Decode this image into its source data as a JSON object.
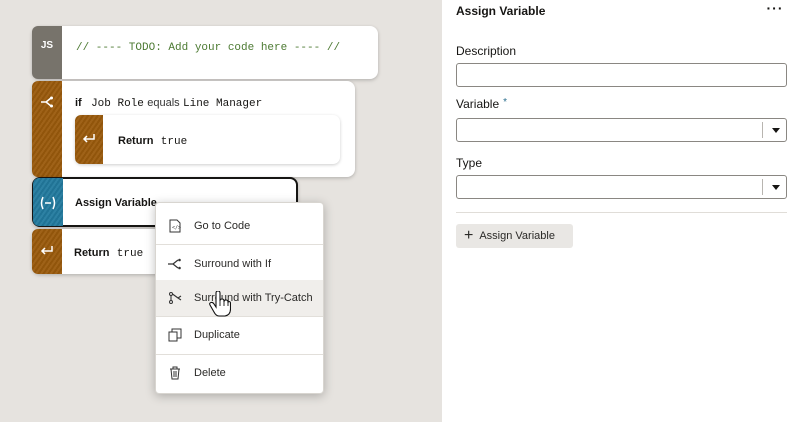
{
  "canvas": {
    "js_block": {
      "badge": "JS",
      "code": "// ---- TODO: Add your code here ---- //"
    },
    "if_block": {
      "keyword": "if",
      "left": "Job Role",
      "operator": "equals",
      "right": "Line Manager",
      "return": {
        "keyword": "Return",
        "value": "true"
      }
    },
    "assign_block": {
      "label": "Assign Variable"
    },
    "return_block": {
      "keyword": "Return",
      "value": "true"
    }
  },
  "context_menu": {
    "items": [
      {
        "label": "Go to Code",
        "icon": "code-file-icon"
      },
      {
        "label": "Surround with If",
        "icon": "branch-icon"
      },
      {
        "label": "Surround with Try-Catch",
        "icon": "try-catch-icon"
      },
      {
        "label": "Duplicate",
        "icon": "duplicate-icon"
      },
      {
        "label": "Delete",
        "icon": "trash-icon"
      }
    ],
    "hovered": "Surround with Try-Catch"
  },
  "panel": {
    "title": "Assign Variable",
    "more": "···",
    "description_label": "Description",
    "description_value": "",
    "variable_label": "Variable",
    "variable_required": "*",
    "variable_value": "",
    "type_label": "Type",
    "type_value": "",
    "add_button": "Assign Variable"
  },
  "colors": {
    "accent_blue": "#227a9e",
    "accent_orange": "#9a5a0c",
    "js_gray": "#77736b"
  }
}
